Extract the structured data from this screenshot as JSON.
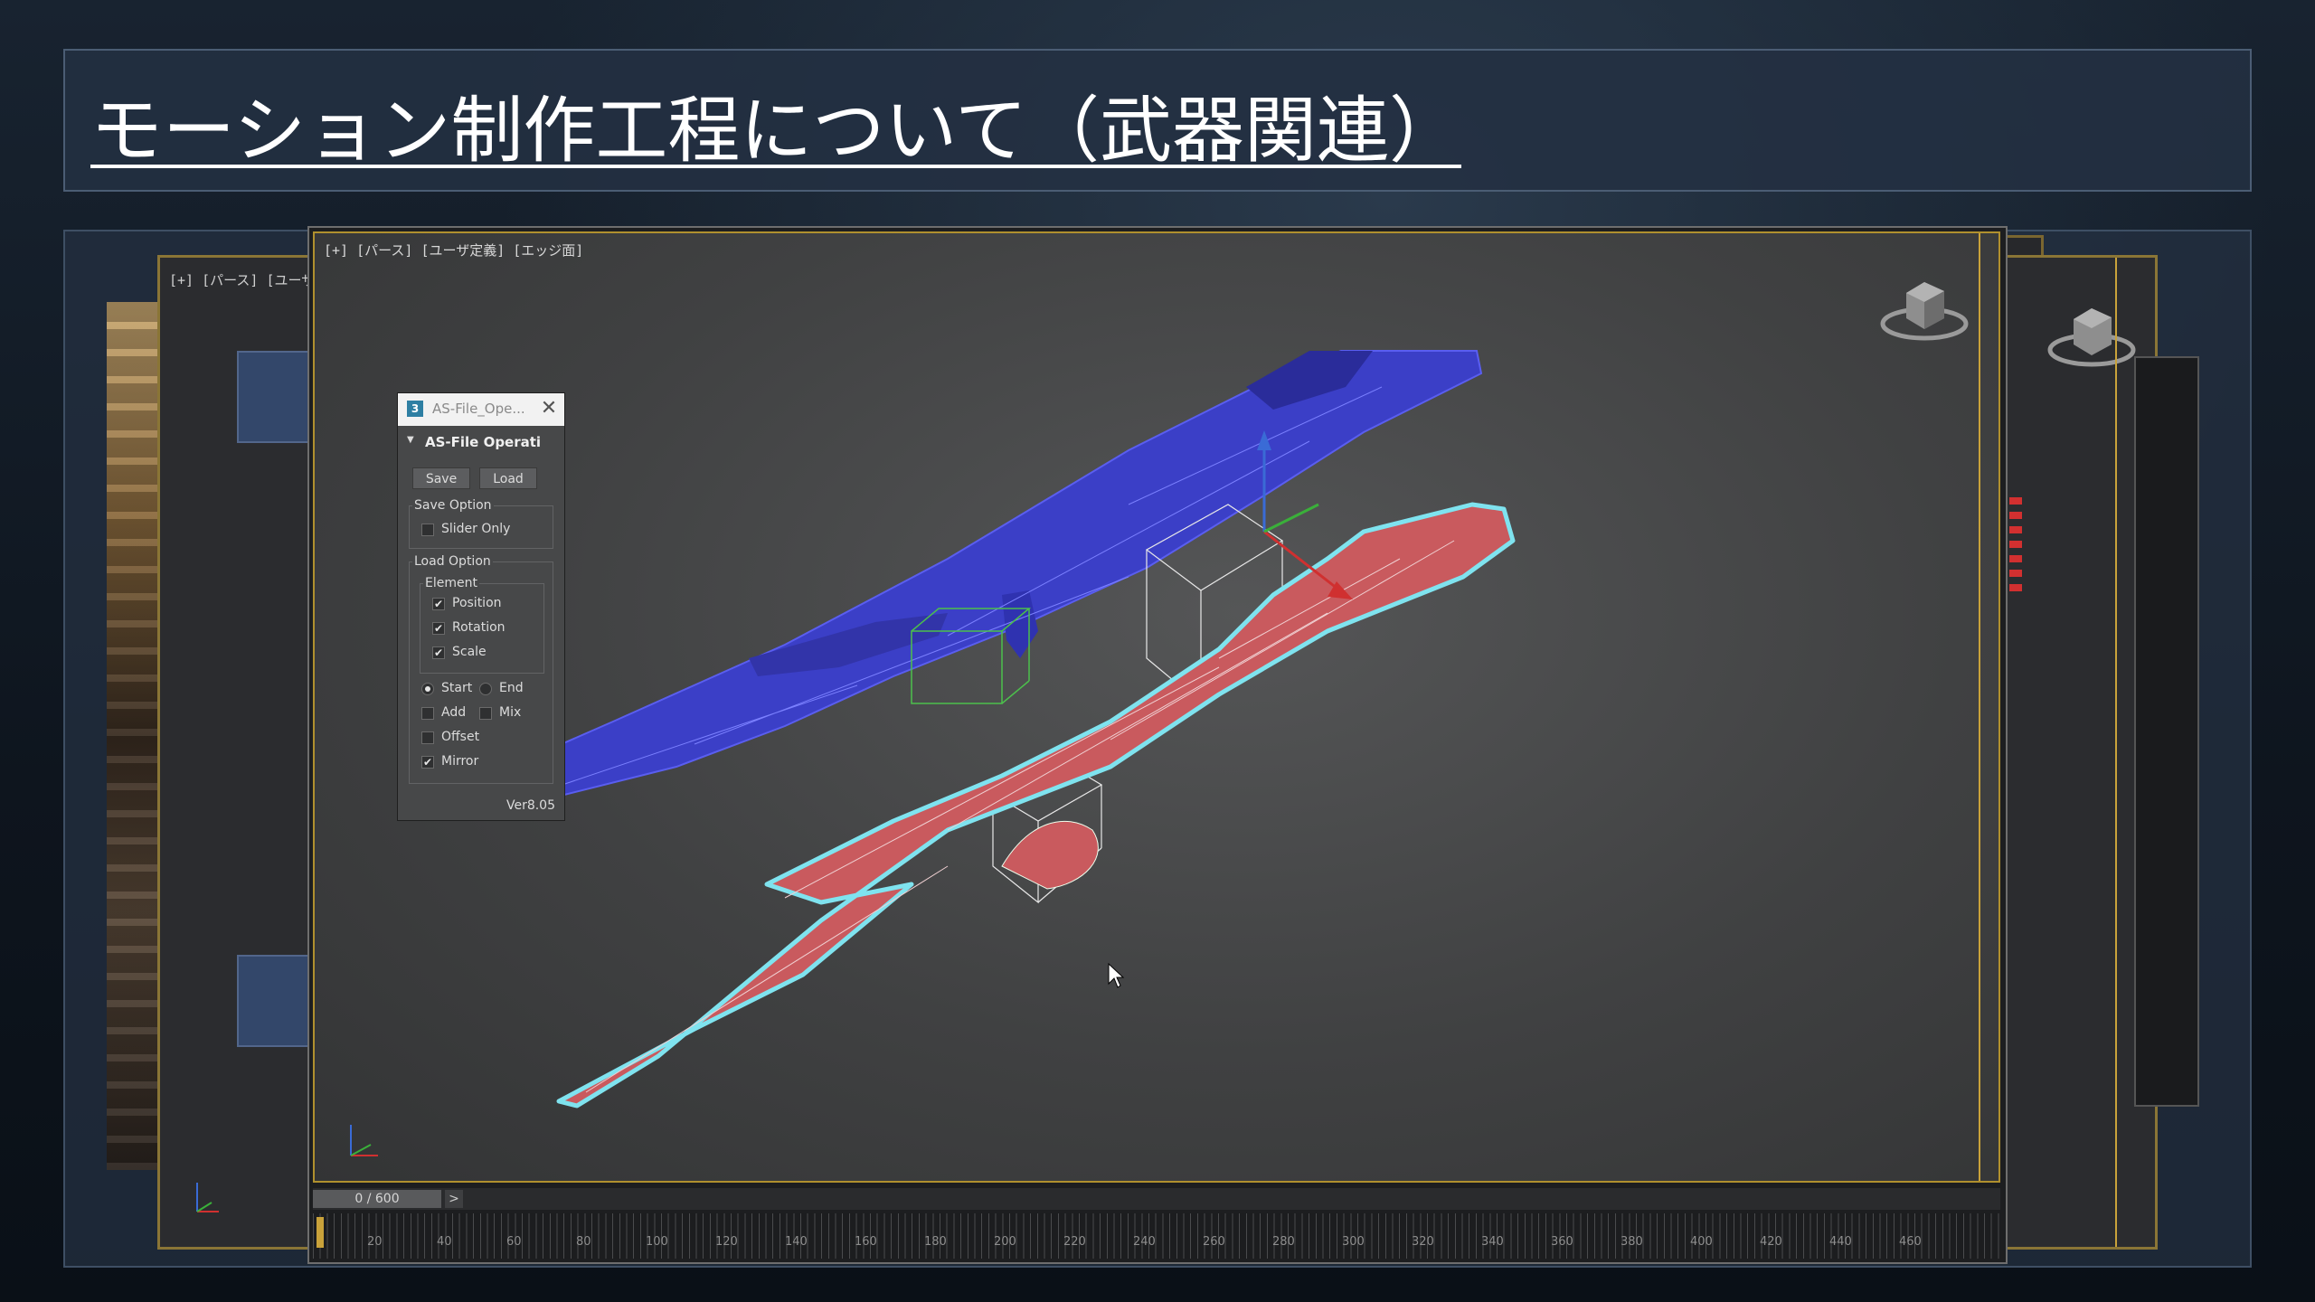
{
  "slide": {
    "title": "モーション制作工程について（武器関連）"
  },
  "viewport": {
    "label": "[+] [パース] [ユーザ定義] [エッジ面]",
    "back_label": "[+] [パース] [ユーザ定"
  },
  "timeline": {
    "frame_display": "0 / 600",
    "next_label": ">",
    "ticks": [
      "20",
      "40",
      "60",
      "80",
      "100",
      "120",
      "140",
      "160",
      "180",
      "200",
      "220",
      "240",
      "260",
      "280",
      "300",
      "320",
      "340",
      "360",
      "380",
      "400",
      "420",
      "440",
      "460"
    ]
  },
  "panel": {
    "window_title": "AS-File_Ope...",
    "app_icon": "3",
    "close_glyph": "✕",
    "rollout_title": "AS-File Operati",
    "save_button": "Save",
    "load_button": "Load",
    "save_option_label": "Save Option",
    "slider_only": {
      "label": "Slider Only",
      "checked": false
    },
    "load_option_label": "Load Option",
    "element_label": "Element",
    "position": {
      "label": "Position",
      "checked": true
    },
    "rotation": {
      "label": "Rotation",
      "checked": true
    },
    "scale": {
      "label": "Scale",
      "checked": true
    },
    "start": {
      "label": "Start",
      "selected": true
    },
    "end": {
      "label": "End",
      "selected": false
    },
    "add": {
      "label": "Add",
      "checked": false
    },
    "mix": {
      "label": "Mix",
      "checked": false
    },
    "offset": {
      "label": "Offset",
      "checked": false
    },
    "mirror": {
      "label": "Mirror",
      "checked": true
    },
    "version": "Ver8.05",
    "check_glyph": "✔"
  },
  "colors": {
    "blue_weapon": "#3b3fc7",
    "red_weapon": "#c95a5e",
    "selection_outline": "#7fe3ef",
    "viewport_border": "#b0902e"
  },
  "icons": [
    "viewcube-icon",
    "cursor-icon",
    "axis-tripod-icon",
    "close-icon",
    "rollout-arrow-icon",
    "app-icon"
  ]
}
